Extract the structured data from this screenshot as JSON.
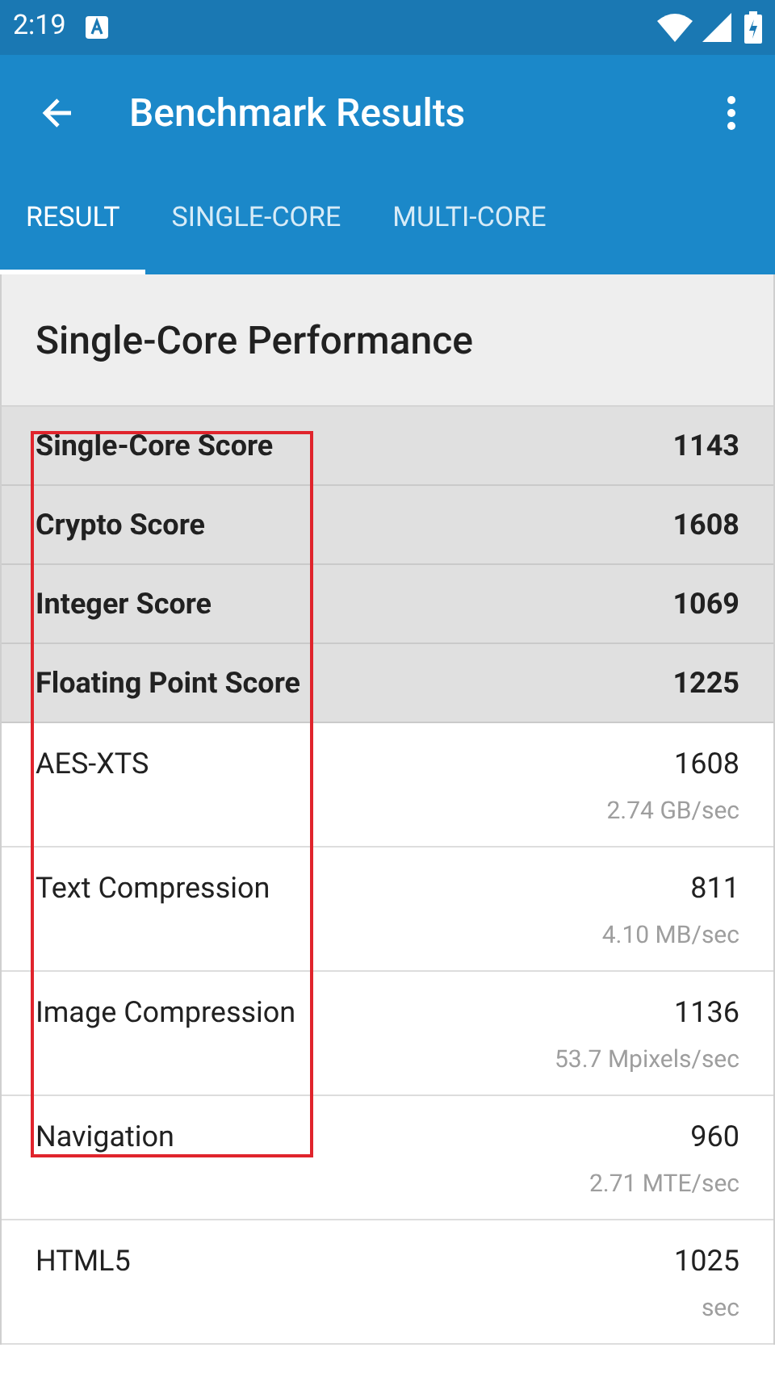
{
  "status_bar": {
    "time": "2:19"
  },
  "app_bar": {
    "title": "Benchmark Results"
  },
  "tabs": [
    {
      "label": "RESULT",
      "selected": true
    },
    {
      "label": "SINGLE-CORE",
      "selected": false
    },
    {
      "label": "MULTI-CORE",
      "selected": false
    }
  ],
  "section": {
    "title": "Single-Core Performance"
  },
  "rows": [
    {
      "kind": "summary",
      "name": "Single-Core Score",
      "score": "1143"
    },
    {
      "kind": "summary",
      "name": "Crypto Score",
      "score": "1608"
    },
    {
      "kind": "summary",
      "name": "Integer Score",
      "score": "1069"
    },
    {
      "kind": "summary",
      "name": "Floating Point Score",
      "score": "1225"
    },
    {
      "kind": "detail",
      "name": "AES-XTS",
      "score": "1608",
      "rate": "2.74 GB/sec"
    },
    {
      "kind": "detail",
      "name": "Text Compression",
      "score": "811",
      "rate": "4.10 MB/sec"
    },
    {
      "kind": "detail",
      "name": "Image Compression",
      "score": "1136",
      "rate": "53.7 Mpixels/sec"
    },
    {
      "kind": "detail",
      "name": "Navigation",
      "score": "960",
      "rate": "2.71 MTE/sec"
    },
    {
      "kind": "detail",
      "name": "HTML5",
      "score": "1025",
      "rate": "sec"
    }
  ]
}
